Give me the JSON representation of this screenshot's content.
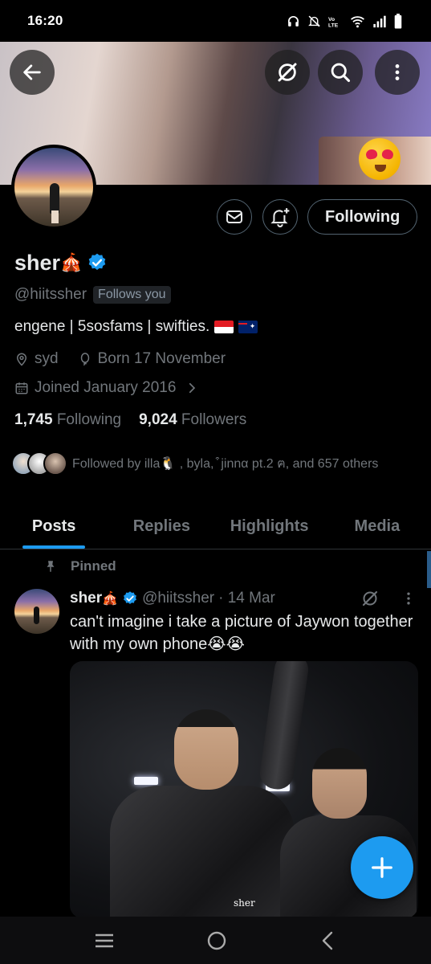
{
  "status_bar": {
    "time": "16:20",
    "icons": [
      "headphones-icon",
      "bell-muted-icon",
      "volte-icon",
      "wifi-icon",
      "signal-icon",
      "battery-icon"
    ]
  },
  "header": {
    "back_icon": "arrow-left-icon",
    "actions": [
      "grok-icon",
      "search-icon",
      "more-vertical-icon"
    ]
  },
  "profile": {
    "display_name": "sher",
    "name_emoji": "🎪",
    "verified": true,
    "handle": "@hiitssher",
    "follows_you_label": "Follows you",
    "bio": "engene | 5sosfams | swifties.",
    "bio_flags": [
      "indonesia-flag",
      "australia-flag"
    ],
    "location": "syd",
    "birthday": "Born 17 November",
    "joined": "Joined January 2016",
    "following_count": "1,745",
    "following_label": "Following",
    "followers_count": "9,024",
    "followers_label": "Followers",
    "followed_by_text": "Followed by illa🐧 , byla,  ͒ jinnα pt.2 ฅ, and 657 others",
    "action_buttons": {
      "message_icon": "envelope-icon",
      "notify_icon": "bell-plus-icon",
      "following_label": "Following"
    }
  },
  "tabs": [
    {
      "label": "Posts",
      "active": true
    },
    {
      "label": "Replies",
      "active": false
    },
    {
      "label": "Highlights",
      "active": false
    },
    {
      "label": "Media",
      "active": false
    }
  ],
  "pinned_post": {
    "pinned_label": "Pinned",
    "author_name": "sher",
    "author_emoji": "🎪",
    "verified": true,
    "author_handle": "@hiitssher",
    "date": "· 14 Mar",
    "text": "can't imagine i take a picture of Jaywon together with my own phone😭😭",
    "media_watermark": "sher"
  },
  "fab": {
    "icon": "plus-icon"
  },
  "nav": [
    "recents-icon",
    "home-circle-icon",
    "back-chevron-icon"
  ],
  "colors": {
    "accent": "#1d9bf0",
    "secondary_text": "#71767b",
    "border": "#536471"
  }
}
